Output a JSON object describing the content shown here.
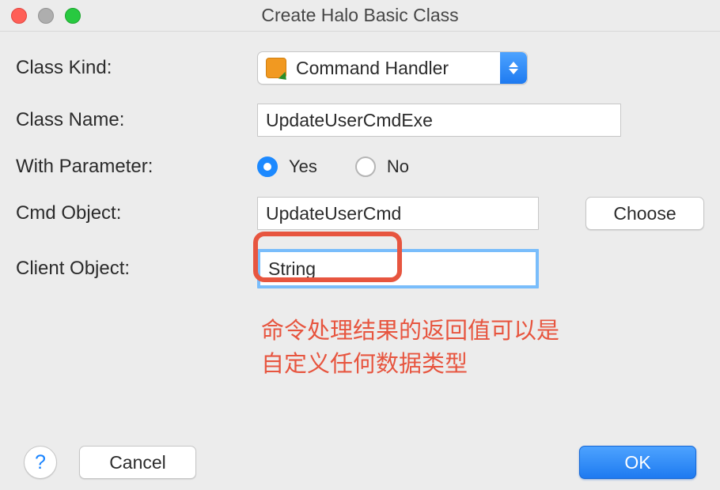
{
  "window": {
    "title": "Create Halo Basic Class"
  },
  "labels": {
    "class_kind": "Class Kind:",
    "class_name": "Class  Name:",
    "with_parameter": "With Parameter:",
    "cmd_object": "Cmd Object:",
    "client_object": "Client Object:"
  },
  "fields": {
    "class_kind_value": "Command Handler",
    "class_name_value": "UpdateUserCmdExe",
    "with_parameter_value": "Yes",
    "cmd_object_value": "UpdateUserCmd",
    "client_object_value": "String"
  },
  "radio": {
    "yes": "Yes",
    "no": "No"
  },
  "buttons": {
    "choose": "Choose",
    "help": "?",
    "cancel": "Cancel",
    "ok": "OK"
  },
  "annotation": {
    "line1": "命令处理结果的返回值可以是",
    "line2": "自定义任何数据类型"
  }
}
